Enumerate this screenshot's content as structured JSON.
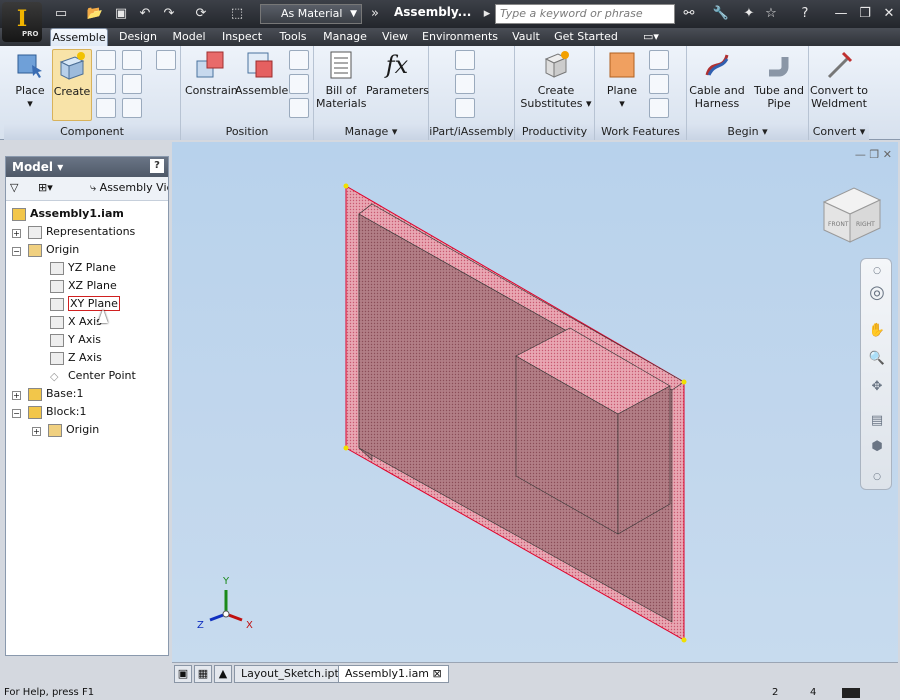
{
  "qat": {
    "material": "As Material",
    "doc_title": "Assembly...",
    "search_placeholder": "Type a keyword or phrase",
    "app_logo": "I",
    "app_edition": "PRO"
  },
  "tabs": [
    "Assemble",
    "Design",
    "Model",
    "Inspect",
    "Tools",
    "Manage",
    "View",
    "Environments",
    "Vault",
    "Get Started"
  ],
  "ribbon": {
    "component": {
      "title": "Component",
      "place": "Place",
      "create": "Create"
    },
    "position": {
      "title": "Position",
      "constrain": "Constrain",
      "assemble": "Assemble"
    },
    "manage": {
      "title": "Manage",
      "bom_line1": "Bill of",
      "bom_line2": "Materials",
      "params": "Parameters"
    },
    "ipart": {
      "title": "iPart/iAssembly"
    },
    "productivity": {
      "title": "Productivity",
      "cs1": "Create",
      "cs2": "Substitutes"
    },
    "work": {
      "title": "Work Features",
      "plane": "Plane"
    },
    "begin": {
      "title": "Begin",
      "cable1": "Cable and",
      "cable2": "Harness",
      "tube1": "Tube and",
      "tube2": "Pipe"
    },
    "convert": {
      "title": "Convert",
      "c1": "Convert to",
      "c2": "Weldment"
    }
  },
  "model_browser": {
    "title": "Model",
    "view": "Assembly View",
    "tree": [
      "Assembly1.iam",
      "Representations",
      "Origin",
      "YZ Plane",
      "XZ Plane",
      "XY Plane",
      "X Axis",
      "Y Axis",
      "Z Axis",
      "Center Point",
      "Base:1",
      "Block:1",
      "Origin"
    ]
  },
  "viewcube": {
    "front": "FRONT",
    "right": "RIGHT"
  },
  "axes": {
    "x": "X",
    "y": "Y",
    "z": "Z"
  },
  "doc_tabs": [
    "Layout_Sketch.ipt",
    "Assembly1.iam"
  ],
  "status": {
    "help": "For Help, press F1",
    "n1": "2",
    "n2": "4"
  },
  "colors": {
    "accent": "#f0b400",
    "plane_edge": "#e0002a"
  }
}
